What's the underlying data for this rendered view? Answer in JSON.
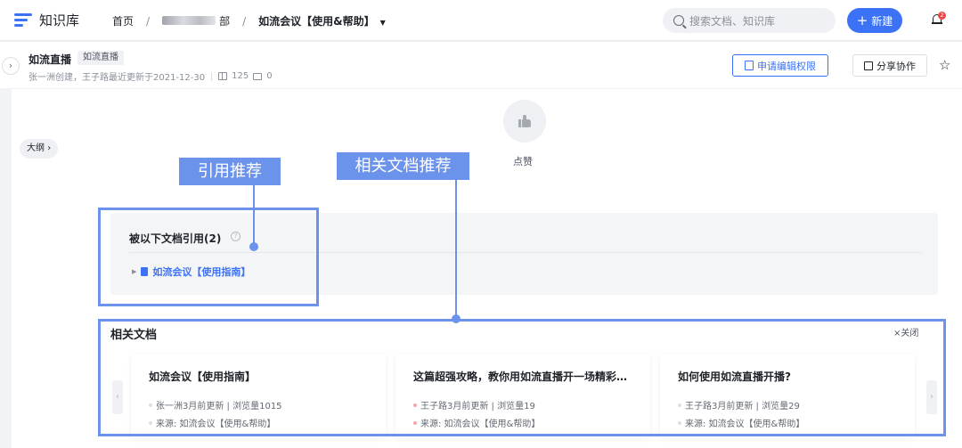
{
  "app": {
    "name": "知识库"
  },
  "breadcrumb": {
    "home": "首页",
    "separator": "/",
    "dept_suffix": "部",
    "current": "如流会议【使用&帮助】"
  },
  "search": {
    "placeholder": "搜索文档、知识库"
  },
  "toolbar": {
    "new_label": "新建",
    "new_plus": "+",
    "notification_count": "2"
  },
  "doc": {
    "title": "如流直播",
    "tag": "如流直播",
    "meta": "张一洲创建，王子路最近更新于2021-12-30",
    "views": "125",
    "comments": "0",
    "apply_edit_label": "申请编辑权限",
    "share_label": "分享协作",
    "star_glyph": "☆"
  },
  "sidebar": {
    "outline_label": "大纲",
    "expand_glyph": "›"
  },
  "like": {
    "label": "点赞"
  },
  "annotations": {
    "ref_label": "引用推荐",
    "related_label": "相关文档推荐"
  },
  "references": {
    "title": "被以下文档引用(2)",
    "help_glyph": "?",
    "items": [
      {
        "label": "如流会议【使用指南】"
      }
    ]
  },
  "related": {
    "title": "相关文档",
    "close_label": "×关闭",
    "cards": [
      {
        "title": "如流会议【使用指南】",
        "updated": "张一洲3月前更新 | 浏览量1015",
        "source": "来源: 如流会议【使用&帮助】"
      },
      {
        "title": "这篇超强攻略，教你用如流直播开一场精彩的直播",
        "updated": "王子路3月前更新 | 浏览量19",
        "source": "来源: 如流会议【使用&帮助】"
      },
      {
        "title": "如何使用如流直播开播?",
        "updated": "王子路3月前更新 | 浏览量29",
        "source": "来源: 如流会议【使用&帮助】"
      }
    ],
    "prev_glyph": "‹",
    "next_glyph": "›"
  },
  "colors": {
    "accent": "#3c72f6",
    "annotation": "#6b93ec"
  }
}
